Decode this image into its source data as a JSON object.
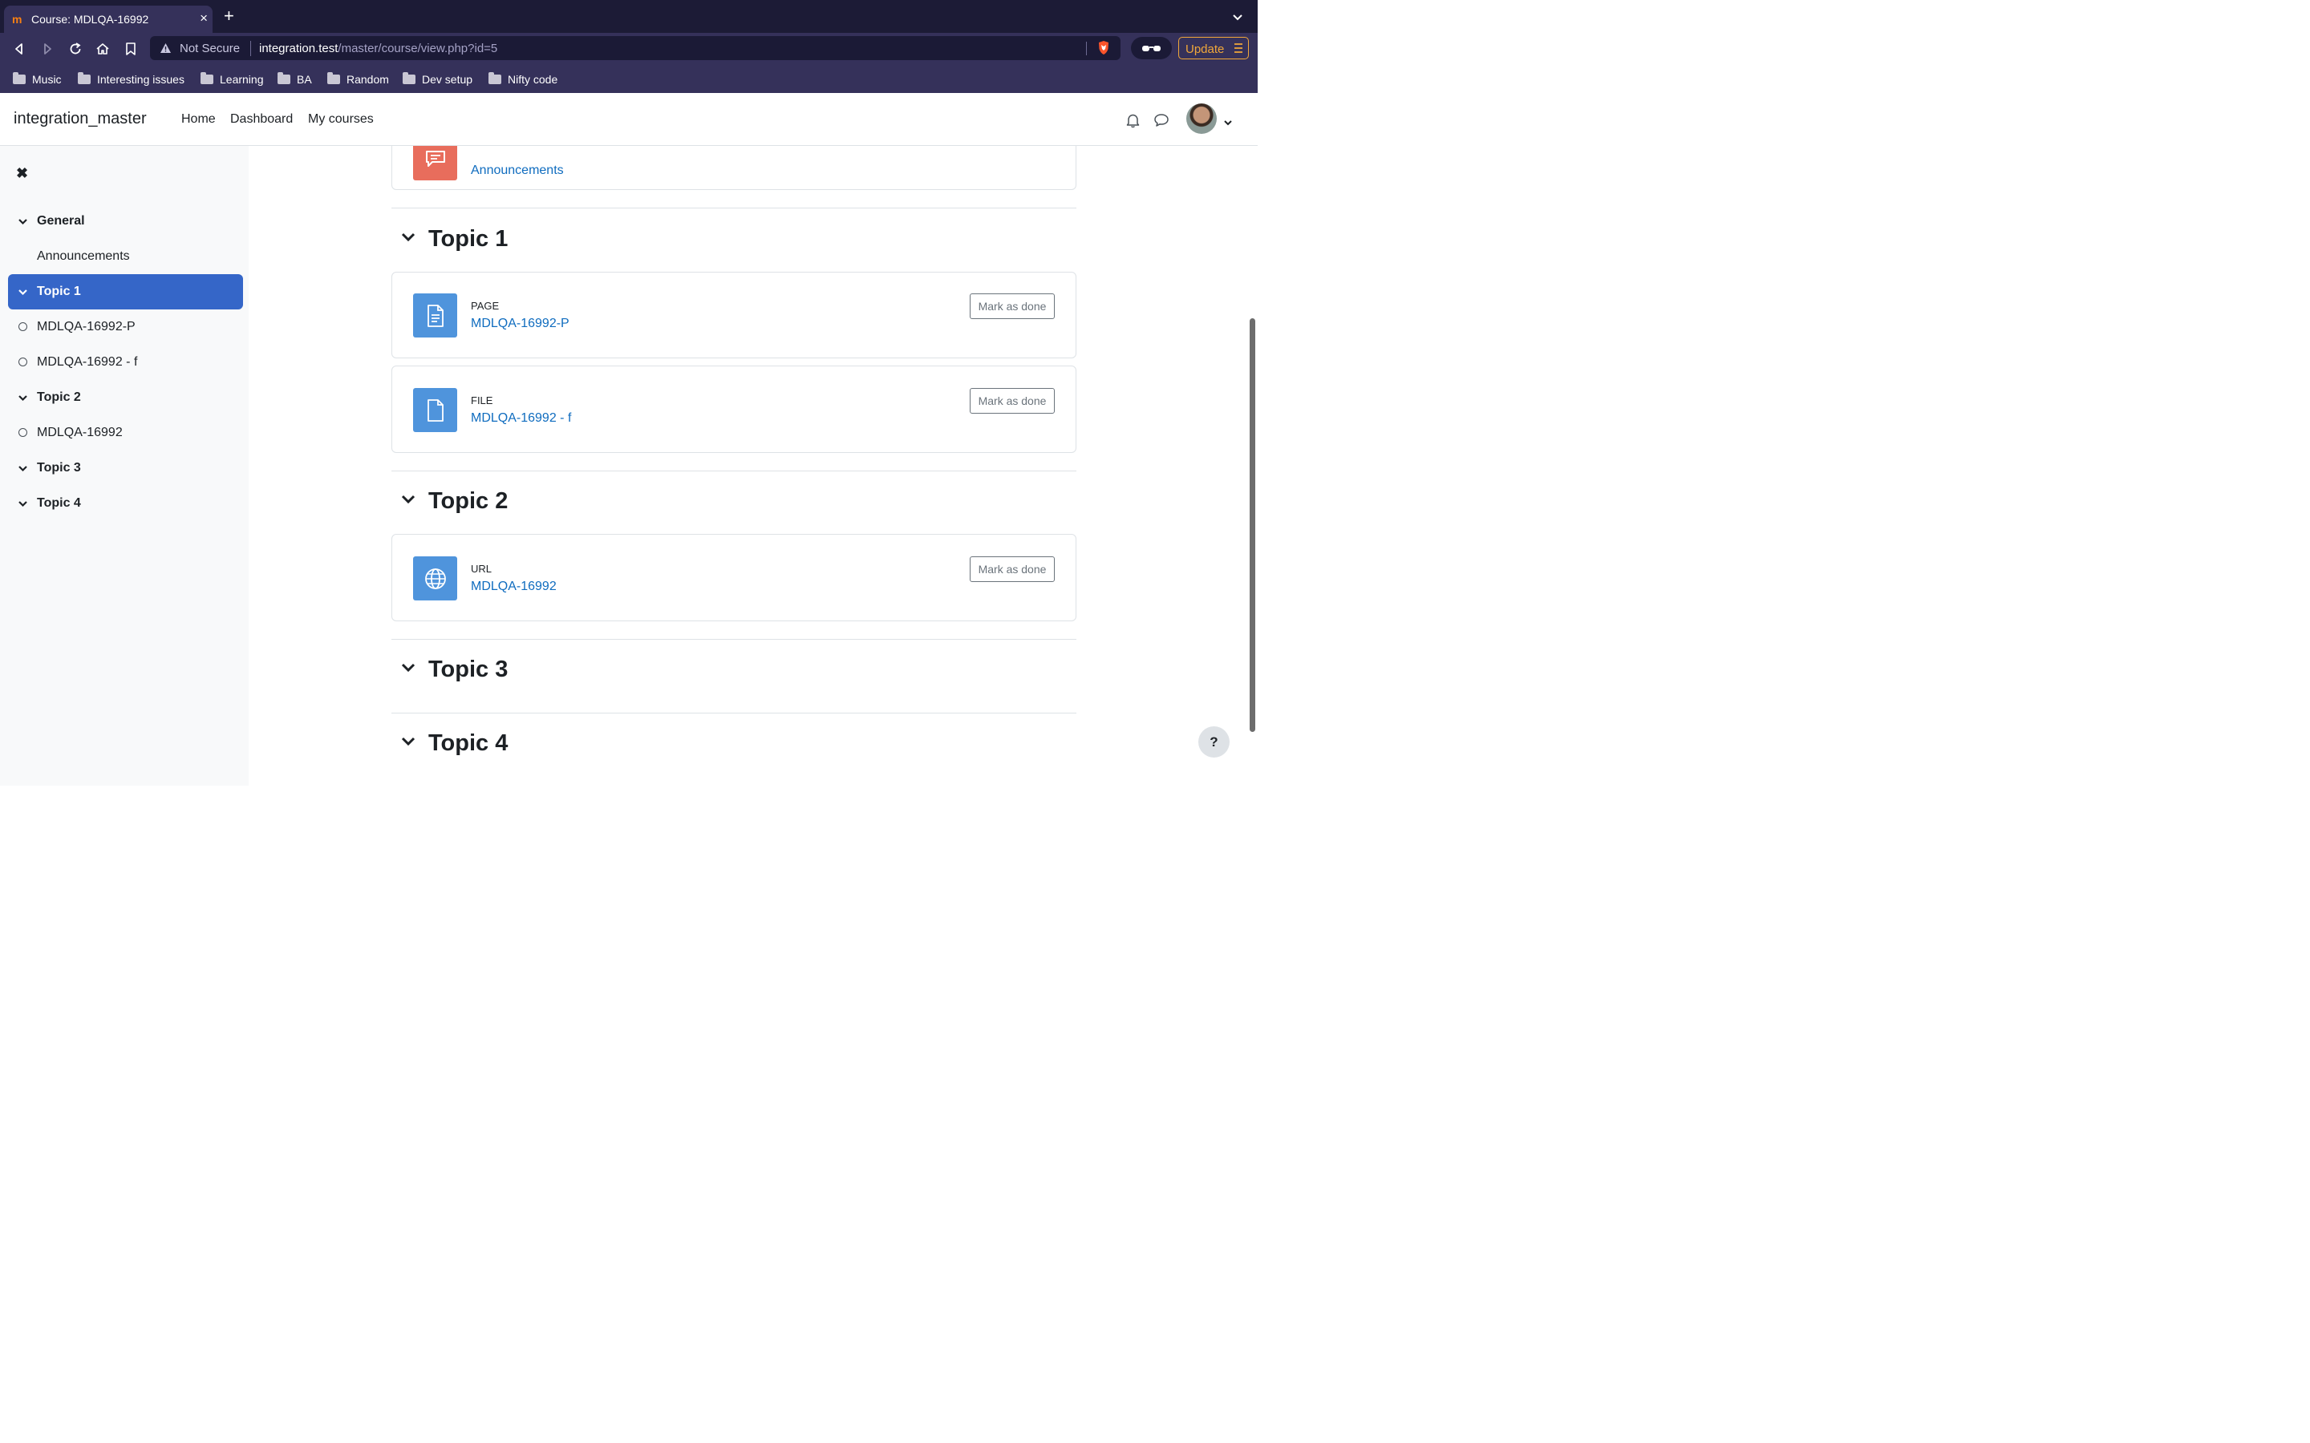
{
  "browser": {
    "tab_title": "Course: MDLQA-16992",
    "url_security": "Not Secure",
    "url_host": "integration.test",
    "url_path": "/master/course/view.php?id=5",
    "update_label": "Update",
    "bookmarks": [
      "Music",
      "Interesting issues",
      "Learning",
      "BA",
      "Random",
      "Dev setup",
      "Nifty code"
    ]
  },
  "navbar": {
    "site_name": "integration_master",
    "links": [
      "Home",
      "Dashboard",
      "My courses"
    ]
  },
  "course_index": {
    "items": [
      {
        "label": "General",
        "kind": "section",
        "active": false
      },
      {
        "label": "Announcements",
        "kind": "activity-plain",
        "active": false
      },
      {
        "label": "Topic 1",
        "kind": "section",
        "active": true
      },
      {
        "label": "MDLQA-16992-P",
        "kind": "activity",
        "active": false
      },
      {
        "label": "MDLQA-16992 - f",
        "kind": "activity",
        "active": false
      },
      {
        "label": "Topic 2",
        "kind": "section",
        "active": false
      },
      {
        "label": "MDLQA-16992",
        "kind": "activity",
        "active": false
      },
      {
        "label": "Topic 3",
        "kind": "section",
        "active": false
      },
      {
        "label": "Topic 4",
        "kind": "section",
        "active": false
      }
    ]
  },
  "main": {
    "announcements": {
      "name": "Announcements"
    },
    "sections": [
      {
        "title": "Topic 1"
      },
      {
        "title": "Topic 2"
      },
      {
        "title": "Topic 3"
      },
      {
        "title": "Topic 4"
      }
    ],
    "activities": [
      {
        "type": "PAGE",
        "name": "MDLQA-16992-P",
        "button": "Mark as done"
      },
      {
        "type": "FILE",
        "name": "MDLQA-16992 - f",
        "button": "Mark as done"
      },
      {
        "type": "URL",
        "name": "MDLQA-16992",
        "button": "Mark as done"
      }
    ]
  },
  "help": {
    "label": "?"
  },
  "colors": {
    "brand_blue": "#0f6cbf",
    "active_index": "#3566c8",
    "resource_icon": "#4f94dc",
    "forum_icon": "#e86d5c"
  }
}
